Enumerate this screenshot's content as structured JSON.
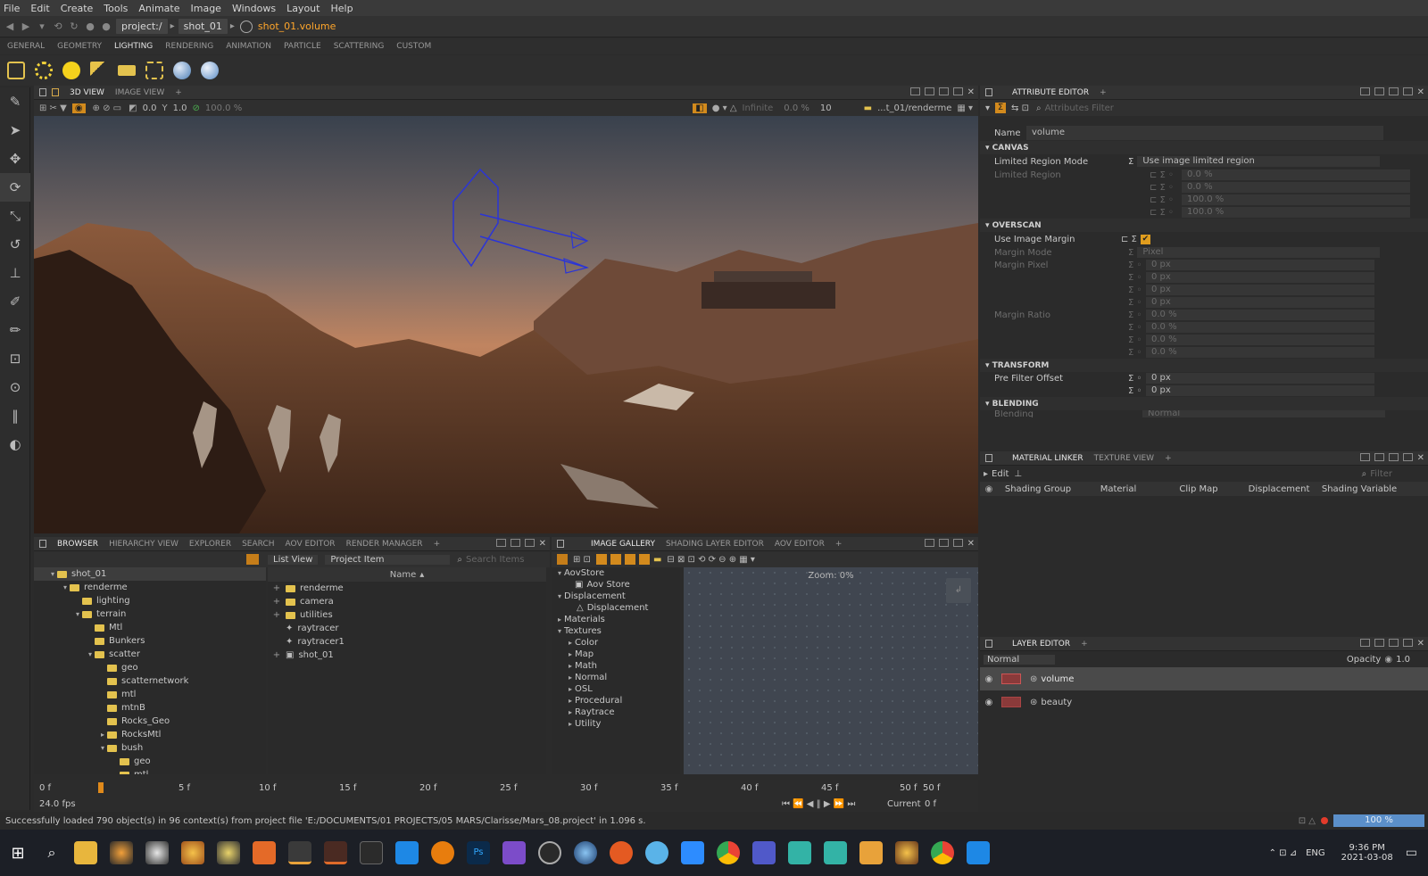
{
  "menu": [
    "File",
    "Edit",
    "Create",
    "Tools",
    "Animate",
    "Image",
    "Windows",
    "Layout",
    "Help"
  ],
  "path": {
    "project": "project:/",
    "shot": "shot_01",
    "active": "shot_01.volume"
  },
  "shelf_tabs": [
    "GENERAL",
    "GEOMETRY",
    "LIGHTING",
    "RENDERING",
    "ANIMATION",
    "PARTICLE",
    "SCATTERING",
    "CUSTOM"
  ],
  "shelf_active": "LIGHTING",
  "viewport": {
    "tabs": [
      "3D VIEW",
      "IMAGE VIEW"
    ],
    "v_rot": "0.0",
    "v_gamma": "1.0",
    "v_pct": "100.0 %",
    "infinite": "Infinite",
    "pct2": "0.0 %",
    "samples": "10",
    "camera_path": "...t_01/renderme"
  },
  "browser": {
    "tabs": [
      "BROWSER",
      "HIERARCHY VIEW",
      "EXPLORER",
      "SEARCH",
      "AOV EDITOR",
      "RENDER MANAGER"
    ],
    "tree": [
      "shot_01",
      "renderme",
      "lighting",
      "terrain",
      "Mtl",
      "Bunkers",
      "scatter",
      "geo",
      "scatternetwork",
      "mtl",
      "mtnB",
      "Rocks_Geo",
      "RocksMtl",
      "bush",
      "geo",
      "mtl"
    ],
    "list_view": "List View",
    "project_item": "Project Item",
    "search_placeholder": "Search Items",
    "col_name": "Name",
    "items": [
      "renderme",
      "camera",
      "utilities",
      "raytracer",
      "raytracer1",
      "shot_01"
    ]
  },
  "gallery": {
    "tabs": [
      "IMAGE GALLERY",
      "SHADING LAYER EDITOR",
      "AOV EDITOR"
    ],
    "zoom": "Zoom: 0%",
    "tree": [
      "AovStore",
      "Aov Store",
      "Displacement",
      "Displacement",
      "Materials",
      "Textures",
      "Color",
      "Map",
      "Math",
      "Normal",
      "OSL",
      "Procedural",
      "Raytrace",
      "Utility"
    ]
  },
  "timeline": {
    "start": "0 f",
    "ticks": [
      "5 f",
      "10 f",
      "15 f",
      "20 f",
      "25 f",
      "30 f",
      "35 f",
      "40 f",
      "45 f",
      "50 f"
    ],
    "end": "50 f",
    "fps": "24.0 fps",
    "current_label": "Current",
    "current": "0 f"
  },
  "attr": {
    "tab": "ATTRIBUTE EDITOR",
    "filter": "Attributes Filter",
    "name_label": "Name",
    "name": "volume",
    "canvas": "CANVAS",
    "lrm_label": "Limited Region Mode",
    "lrm": "Use image limited region",
    "lr_label": "Limited Region",
    "lr": [
      "0.0 %",
      "0.0 %",
      "100.0 %",
      "100.0 %"
    ],
    "overscan": "OVERSCAN",
    "uim_label": "Use Image Margin",
    "mm_label": "Margin Mode",
    "mm": "Pixel",
    "mp_label": "Margin Pixel",
    "mp": [
      "0 px",
      "0 px",
      "0 px",
      "0 px"
    ],
    "mr_label": "Margin Ratio",
    "mr": [
      "0.0 %",
      "0.0 %",
      "0.0 %",
      "0.0 %"
    ],
    "transform": "TRANSFORM",
    "pfo_label": "Pre Filter Offset",
    "pfo": [
      "0 px",
      "0 px"
    ],
    "blending": "BLENDING",
    "bl_label": "Blending",
    "bl": "Normal"
  },
  "matlinker": {
    "tabs": [
      "MATERIAL LINKER",
      "TEXTURE VIEW"
    ],
    "edit": "Edit",
    "filter": "Filter",
    "cols": [
      "Shading Group",
      "Material",
      "Clip Map",
      "Displacement",
      "Shading Variable"
    ]
  },
  "layers": {
    "tab": "LAYER EDITOR",
    "mode": "Normal",
    "opacity_label": "Opacity",
    "opacity": "1.0",
    "items": [
      "volume",
      "beauty"
    ]
  },
  "status": {
    "message": "Successfully loaded 790 object(s) in 96 context(s) from project file 'E:/DOCUMENTS/01 PROJECTS/05 MARS/Clarisse/Mars_08.project' in 1.096 s.",
    "progress": "100 %"
  },
  "taskbar": {
    "lang": "ENG",
    "time": "9:36 PM",
    "date": "2021-03-08"
  }
}
